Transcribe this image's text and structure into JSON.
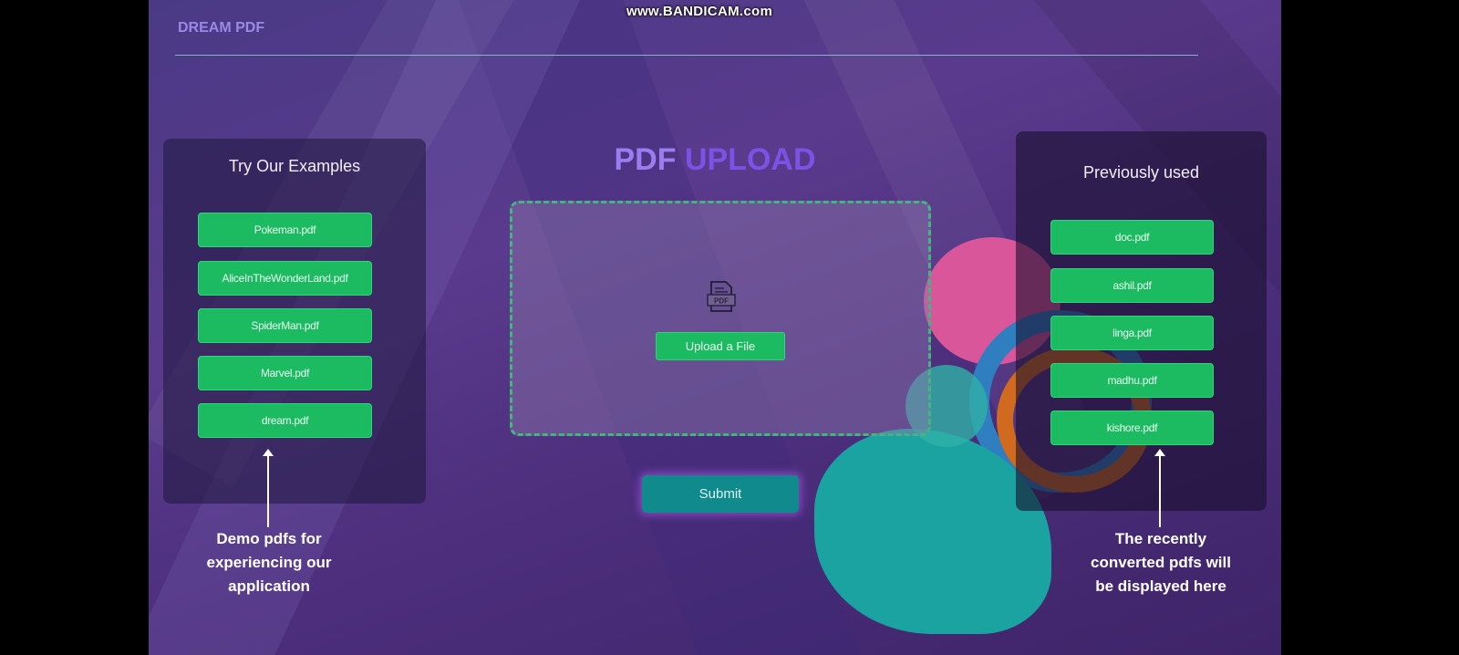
{
  "watermark": "www.BANDICAM.com",
  "header": {
    "logo": "DREAM PDF"
  },
  "title": {
    "part1": "PDF",
    "part2": "UPLOAD"
  },
  "examples": {
    "title": "Try Our Examples",
    "items": [
      "Pokeman.pdf",
      "AliceInTheWonderLand.pdf",
      "SpiderMan.pdf",
      "Marvel.pdf",
      "dream.pdf"
    ]
  },
  "previous": {
    "title": "Previously used",
    "items": [
      "doc.pdf",
      "ashil.pdf",
      "linga.pdf",
      "madhu.pdf",
      "kishore.pdf"
    ]
  },
  "upload": {
    "icon_label": "PDF",
    "button": "Upload a File"
  },
  "submit": "Submit",
  "captions": {
    "left": [
      "Demo pdfs for",
      "experiencing our",
      "application"
    ],
    "right": [
      "The recently",
      "converted pdfs will",
      "be displayed here"
    ]
  },
  "colors": {
    "green": "#1cbb62",
    "accent": "#7b52e6",
    "submit": "#108a8c"
  }
}
